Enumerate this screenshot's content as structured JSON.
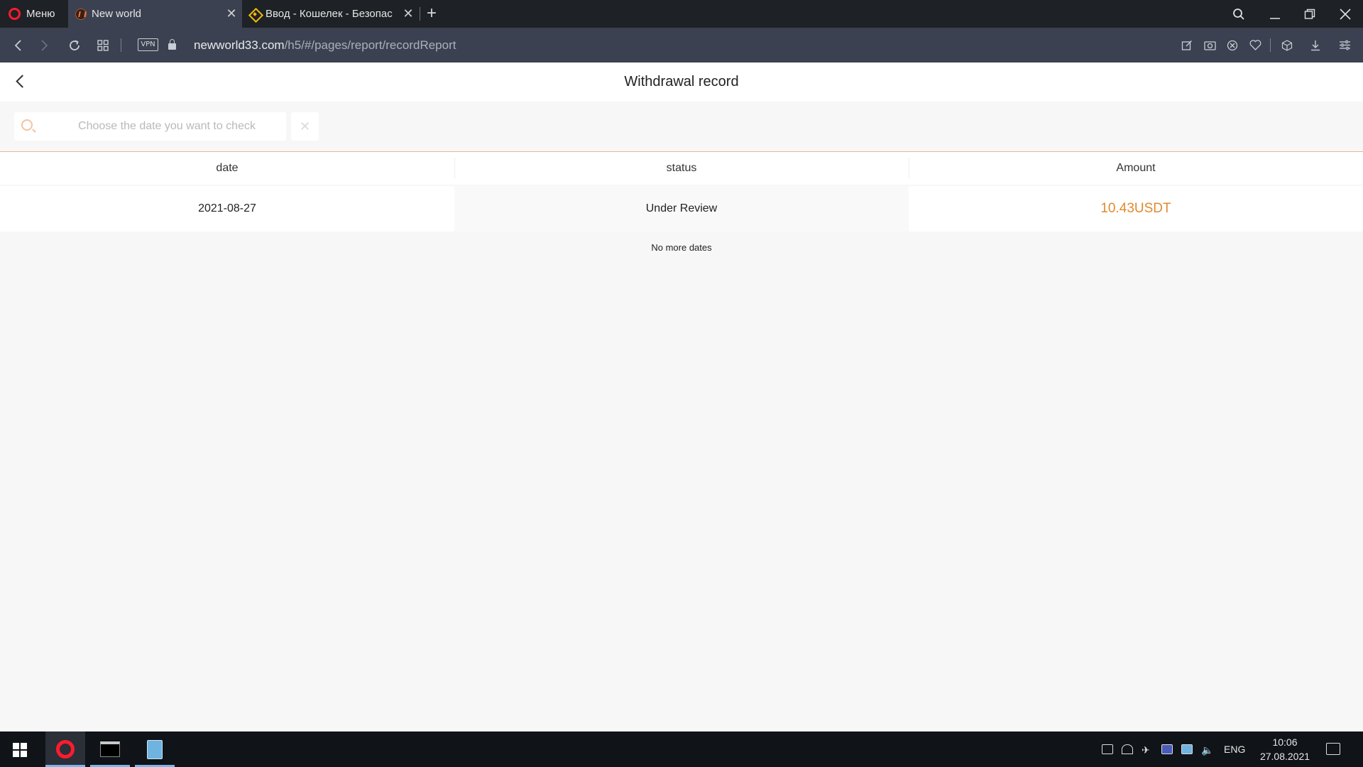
{
  "browser": {
    "menu_label": "Меню",
    "tabs": [
      {
        "title": "New world"
      },
      {
        "title": "Ввод - Кошелек - Безопас"
      }
    ],
    "url_host": "newworld33.com",
    "url_path": "/h5/#/pages/report/recordReport",
    "vpn_label": "VPN"
  },
  "page": {
    "title": "Withdrawal record",
    "search_placeholder": "Choose the date you want to check",
    "clear_symbol": "✕"
  },
  "table": {
    "headers": [
      "date",
      "status",
      "Amount"
    ],
    "rows": [
      {
        "date": "2021-08-27",
        "status": "Under Review",
        "amount": "10.43USDT"
      }
    ],
    "footer": "No more dates"
  },
  "colors": {
    "accent_orange": "#e08a2e",
    "browser_dark": "#1e2126",
    "address_bar": "#3b4150"
  },
  "taskbar": {
    "language": "ENG",
    "time": "10:06",
    "date": "27.08.2021"
  }
}
